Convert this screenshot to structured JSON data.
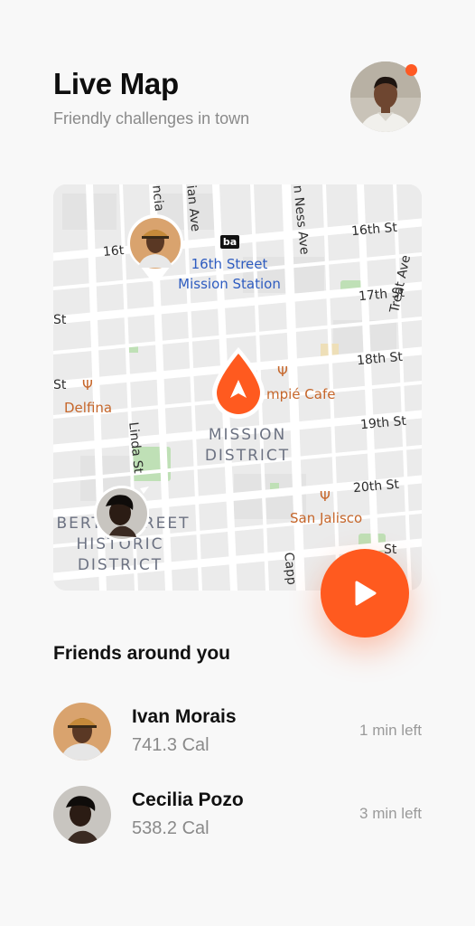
{
  "header": {
    "title": "Live Map",
    "subtitle": "Friendly challenges in town"
  },
  "profile": {
    "avatar_icon": "user-avatar",
    "notification_color": "#ff5a24"
  },
  "map": {
    "streets": [
      "16th St",
      "16th St",
      "17th St",
      "18th St",
      "19th St",
      "20th St",
      "St",
      "St",
      "St",
      "St",
      "Treat Ave",
      "Linda St",
      "Capp",
      "ncia",
      "ian Ave",
      "n Ness Ave"
    ],
    "station_logo": "ba",
    "station_name": [
      "16th Street",
      "Mission Station"
    ],
    "pois": [
      "Delfina",
      "mpie Cafe",
      "San Jalisco"
    ],
    "districts": {
      "mission": [
        "MISSION",
        "DISTRICT"
      ],
      "liberty": [
        "IBERTY STREET",
        "HISTORIC",
        "DISTRICT"
      ]
    },
    "street_labels": {
      "s16_top": "16th St",
      "s16_left": "16t",
      "s17": "17th St",
      "s18": "18th St",
      "s19": "19th St",
      "s20": "20th St",
      "treat": "Treat Ave",
      "linda": "Linda St",
      "capp": "Capp",
      "valencia": "ncia",
      "guerrero": "ian Ave",
      "vanness": "n Ness Ave",
      "st_left1": "St",
      "st_left2": "St",
      "st_right": "St"
    },
    "poi_labels": {
      "delfina": "Delfina",
      "cafe": "mpié Cafe",
      "jalisco": "San Jalisco"
    }
  },
  "friends_section": {
    "title": "Friends around you",
    "friends": [
      {
        "name": "Ivan Morais",
        "calories": "741.3 Cal",
        "time_left": "1 min left"
      },
      {
        "name": "Cecilia Pozo",
        "calories": "538.2 Cal",
        "time_left": "3 min left"
      }
    ]
  },
  "colors": {
    "accent": "#ff5a1f",
    "poi": "#c6662a",
    "station": "#2e5cc0"
  }
}
